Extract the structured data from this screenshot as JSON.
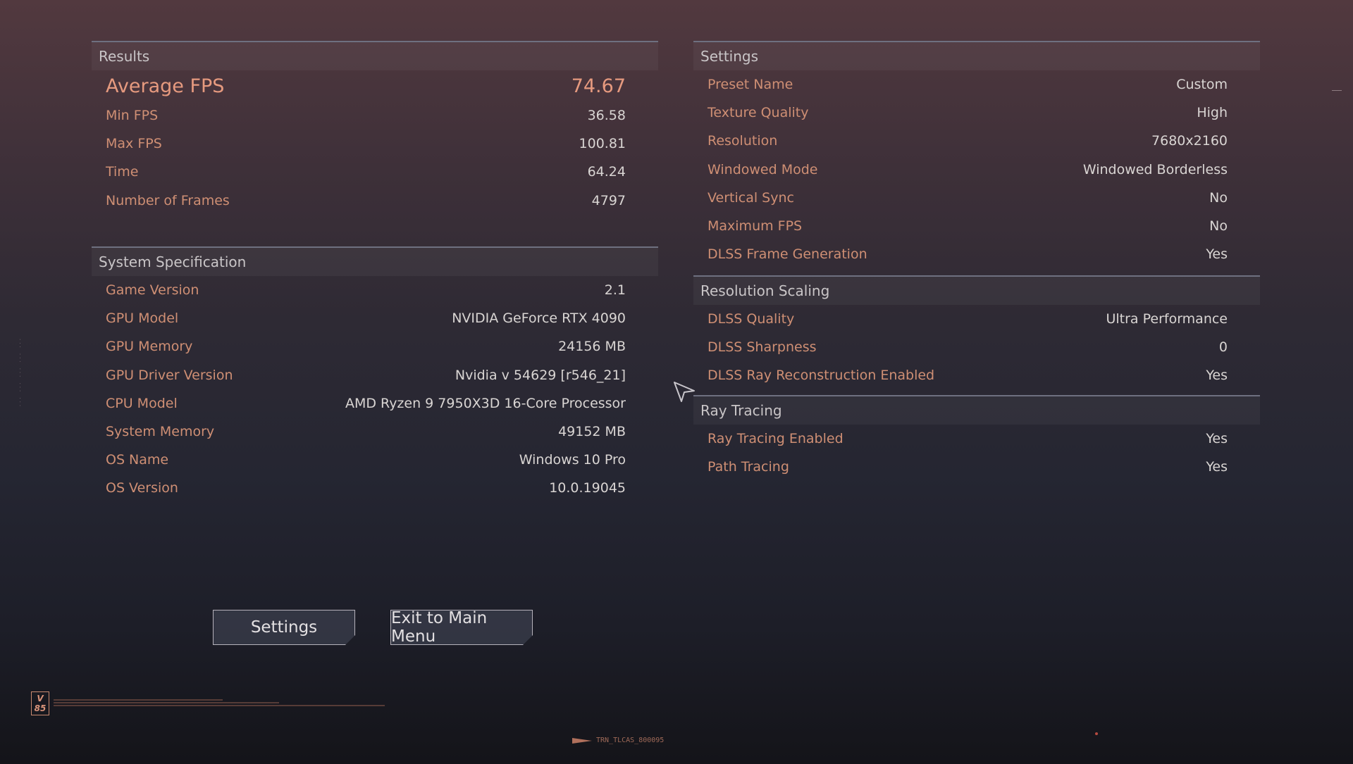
{
  "results": {
    "title": "Results",
    "rows": [
      {
        "label": "Average FPS",
        "value": "74.67"
      },
      {
        "label": "Min FPS",
        "value": "36.58"
      },
      {
        "label": "Max FPS",
        "value": "100.81"
      },
      {
        "label": "Time",
        "value": "64.24"
      },
      {
        "label": "Number of Frames",
        "value": "4797"
      }
    ]
  },
  "system": {
    "title": "System Specification",
    "rows": [
      {
        "label": "Game Version",
        "value": "2.1"
      },
      {
        "label": "GPU Model",
        "value": "NVIDIA GeForce RTX 4090"
      },
      {
        "label": "GPU Memory",
        "value": "24156 MB"
      },
      {
        "label": "GPU Driver Version",
        "value": "Nvidia v 54629 [r546_21]"
      },
      {
        "label": "CPU Model",
        "value": "AMD Ryzen 9 7950X3D 16-Core Processor"
      },
      {
        "label": "System Memory",
        "value": "49152 MB"
      },
      {
        "label": "OS Name",
        "value": "Windows 10 Pro"
      },
      {
        "label": "OS Version",
        "value": "10.0.19045"
      }
    ]
  },
  "settings": {
    "title": "Settings",
    "rows": [
      {
        "label": "Preset Name",
        "value": "Custom"
      },
      {
        "label": "Texture Quality",
        "value": "High"
      },
      {
        "label": "Resolution",
        "value": "7680x2160"
      },
      {
        "label": "Windowed Mode",
        "value": "Windowed Borderless"
      },
      {
        "label": "Vertical Sync",
        "value": "No"
      },
      {
        "label": "Maximum FPS",
        "value": "No"
      },
      {
        "label": "DLSS Frame Generation",
        "value": "Yes"
      }
    ]
  },
  "scaling": {
    "title": "Resolution Scaling",
    "rows": [
      {
        "label": "DLSS Quality",
        "value": "Ultra Performance"
      },
      {
        "label": "DLSS Sharpness",
        "value": "0"
      },
      {
        "label": "DLSS Ray Reconstruction Enabled",
        "value": "Yes"
      }
    ]
  },
  "raytracing": {
    "title": "Ray Tracing",
    "rows": [
      {
        "label": "Ray Tracing Enabled",
        "value": "Yes"
      },
      {
        "label": "Path Tracing",
        "value": "Yes"
      }
    ]
  },
  "buttons": {
    "settings": "Settings",
    "exit": "Exit to Main Menu"
  },
  "footer": {
    "version_badge": "V 85",
    "code": "TRN_TLCAS_800095"
  },
  "icons": {
    "cursor": "pointer-cursor-icon",
    "footer_arrow": "arrow-icon"
  },
  "colors": {
    "label": "#cf8f74",
    "value": "#d9d5d3",
    "highlight": "#e69a7f",
    "header_rule": "#6e7080"
  }
}
